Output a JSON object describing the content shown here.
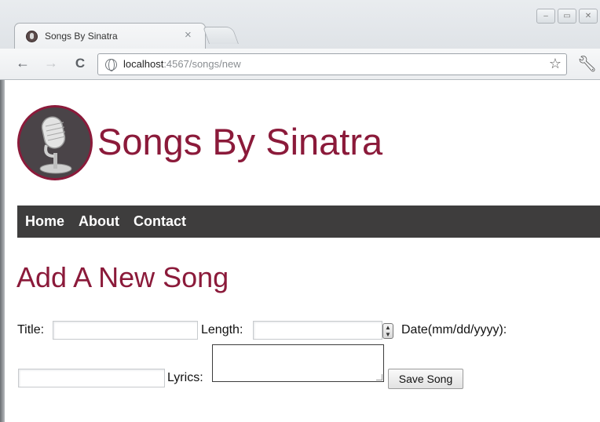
{
  "browser": {
    "tab_title": "Songs By Sinatra",
    "tab_close": "×",
    "url_host": "localhost",
    "url_path": ":4567/songs/new",
    "window_controls": [
      "–",
      "▭",
      "✕"
    ],
    "icons": {
      "back": "back-arrow-icon",
      "forward": "forward-arrow-icon",
      "reload": "reload-icon",
      "globe": "globe-icon",
      "star": "star-icon",
      "wrench": "wrench-icon",
      "favicon": "microphone-favicon-icon"
    }
  },
  "site": {
    "title": "Songs By Sinatra",
    "logo": "microphone-logo-icon",
    "accent_color": "#8b1a3a",
    "nav_color": "#3e3d3d"
  },
  "nav": {
    "items": [
      {
        "label": "Home"
      },
      {
        "label": "About"
      },
      {
        "label": "Contact"
      }
    ]
  },
  "form": {
    "heading": "Add A New Song",
    "title_label": "Title:",
    "title_value": "",
    "length_label": "Length:",
    "length_value": "",
    "date_label": "Date(mm/dd/yyyy):",
    "date_value": "",
    "lyrics_label": "Lyrics:",
    "lyrics_value": "",
    "submit_label": "Save Song"
  }
}
